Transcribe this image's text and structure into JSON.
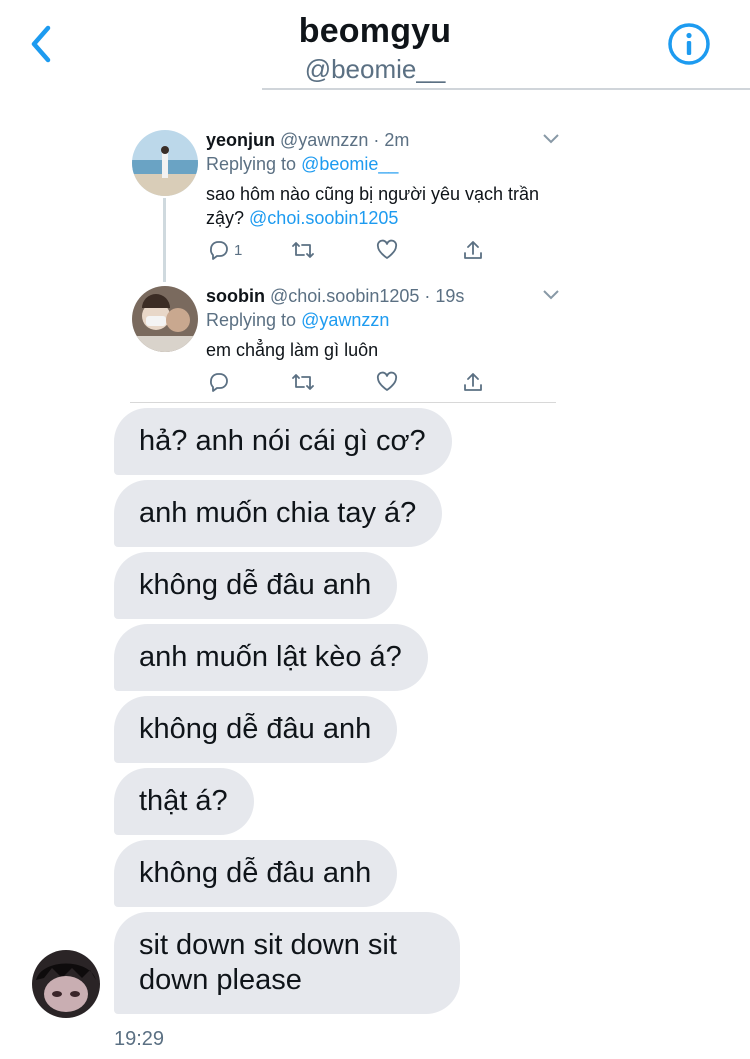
{
  "header": {
    "title": "beomgyu",
    "handle": "@beomie__",
    "accent": "#1d9bf0"
  },
  "tweets": [
    {
      "name": "yeonjun",
      "meta": "@yawnzzn · 2m",
      "replying_label": "Replying to ",
      "replying_to": "@beomie__",
      "text": "sao hôm nào cũng bị người yêu vạch trần zậy? ",
      "mention": "@choi.soobin1205",
      "reply_count": "1"
    },
    {
      "name": "soobin",
      "meta": "@choi.soobin1205 · 19s",
      "replying_label": "Replying to ",
      "replying_to": "@yawnzzn",
      "text": "em chẳng làm gì luôn",
      "reply_count": ""
    }
  ],
  "messages": [
    "hả? anh nói cái gì cơ?",
    "anh muốn chia tay á?",
    "không dễ đâu anh",
    "anh muốn lật kèo á?",
    "không dễ đâu anh",
    "thật á?",
    "không dễ đâu anh",
    "sit down sit down sit down please"
  ],
  "timestamp": "19:29",
  "colors": {
    "bubble": "#e6e8ed",
    "secondary_text": "#5b7083",
    "link": "#1d9bf0"
  }
}
